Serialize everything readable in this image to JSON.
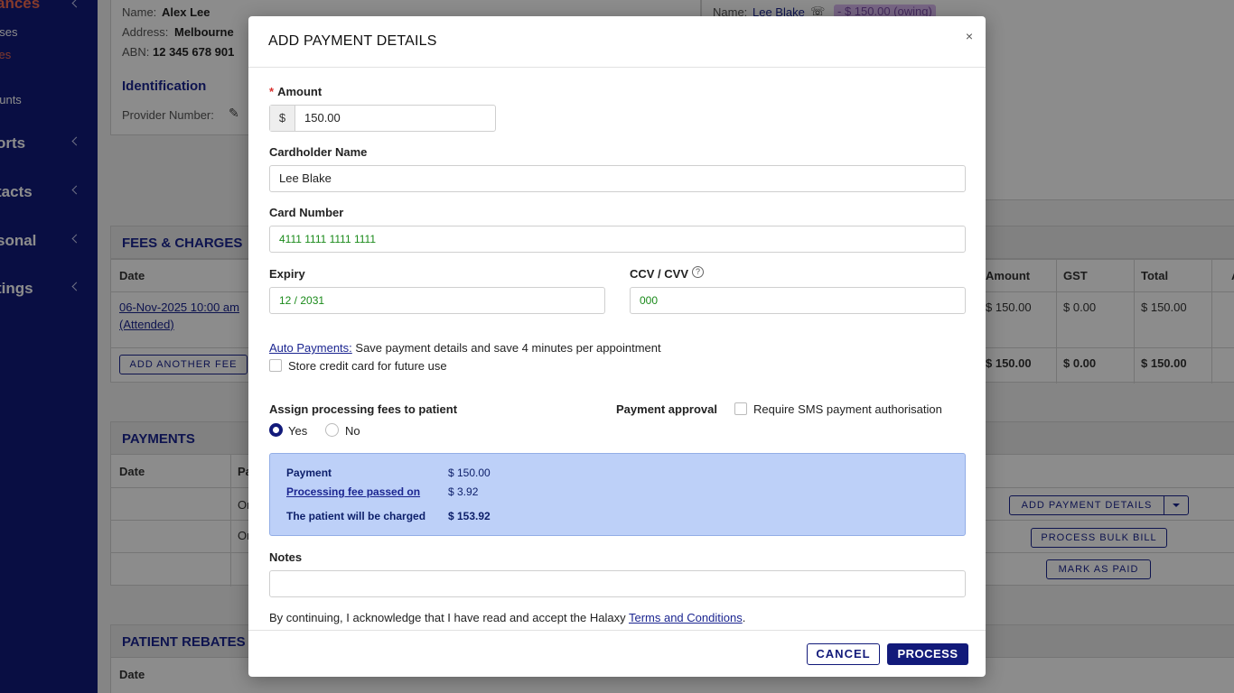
{
  "sidebar": {
    "items": [
      {
        "label": "ances",
        "top": 0
      },
      {
        "label": "nses"
      },
      {
        "label": "ces"
      },
      {
        "label": "ounts"
      },
      {
        "label": "orts"
      },
      {
        "label": "tacts"
      },
      {
        "label": "sonal"
      },
      {
        "label": "tings"
      }
    ]
  },
  "provider": {
    "name_label": "Name:",
    "name": "Alex Lee",
    "address_label": "Address:",
    "address": "Melbourne",
    "abn_label": "ABN:",
    "abn": "12 345 678 901"
  },
  "identification": {
    "title": "Identification",
    "provider_number_label": "Provider Number:"
  },
  "patient": {
    "name_label": "Name:",
    "name": "Lee Blake",
    "owing": "- $ 150.00 (owing)"
  },
  "fees": {
    "title": "FEES & CHARGES",
    "headers": {
      "date": "Date",
      "amount": "Amount",
      "gst": "GST",
      "total": "Total",
      "extra": "A"
    },
    "row": {
      "date": "06-Nov-2025 10:00 am",
      "status": "(Attended)",
      "amount": "$ 150.00",
      "gst": "$ 0.00",
      "total": "$ 150.00"
    },
    "totals": {
      "amount": "$ 150.00",
      "gst": "$ 0.00",
      "total": "$ 150.00"
    },
    "add_fee": "ADD ANOTHER FEE"
  },
  "payments": {
    "title": "PAYMENTS",
    "headers": {
      "date": "Date",
      "pa": "Pa"
    },
    "row1": "Or",
    "row2": "Or",
    "add_payment_details": "ADD PAYMENT DETAILS",
    "process_bulk_bill": "PROCESS BULK BILL",
    "mark_as_paid": "MARK AS PAID"
  },
  "rebates": {
    "title": "PATIENT REBATES",
    "date": "Date"
  },
  "modal": {
    "title": "ADD PAYMENT DETAILS",
    "close": "×",
    "amount_label": "Amount",
    "amount_required": "*",
    "currency": "$",
    "amount_value": "150.00",
    "cardholder_label": "Cardholder Name",
    "cardholder_value": "Lee Blake",
    "card_number_label": "Card Number",
    "card_number_value": "4111 1111 1111 1111",
    "expiry_label": "Expiry",
    "expiry_value": "12 / 2031",
    "ccv_label": "CCV / CVV",
    "ccv_help": "?",
    "ccv_value": "000",
    "auto_payments_link": "Auto Payments:",
    "auto_payments_text": " Save payment details and save 4 minutes per appointment",
    "store_card_label": "Store credit card for future use",
    "processing_fees_label": "Assign processing fees to patient",
    "yes_label": "Yes",
    "no_label": "No",
    "payment_approval_label": "Payment approval",
    "sms_label": "Require SMS payment authorisation",
    "summary": {
      "payment_label": "Payment",
      "payment_value": "$ 150.00",
      "fee_label": "Processing fee passed on",
      "fee_value": "$ 3.92",
      "charged_label": "The patient will be charged",
      "charged_value": "$ 153.92"
    },
    "notes_label": "Notes",
    "terms_text": "By continuing, I acknowledge that I have read and accept the Halaxy ",
    "terms_link": "Terms and Conditions",
    "terms_end": ".",
    "cancel": "CANCEL",
    "process": "PROCESS"
  }
}
